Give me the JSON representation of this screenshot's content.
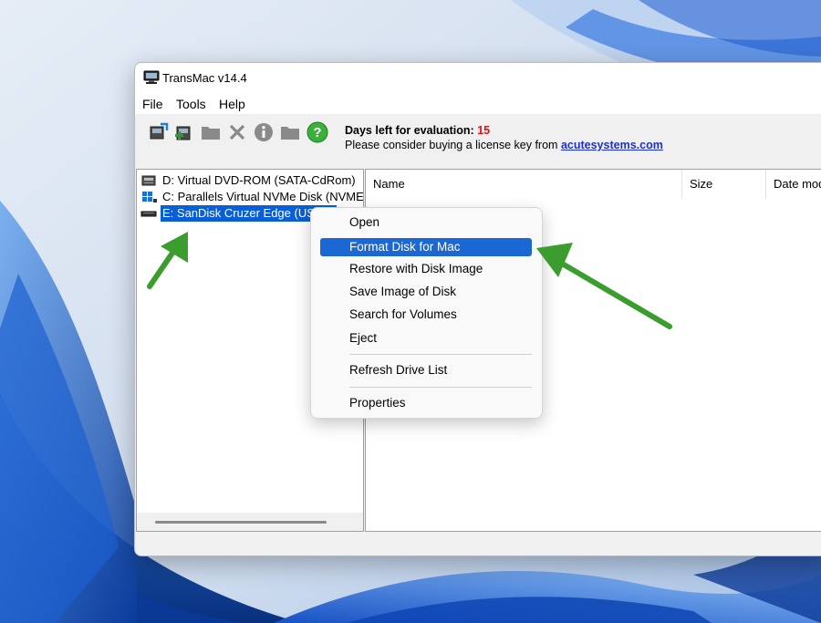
{
  "window": {
    "title": "TransMac v14.4"
  },
  "menubar": {
    "items": [
      "File",
      "Tools",
      "Help"
    ]
  },
  "toolbar": {
    "icons": [
      "refresh-drives-icon",
      "add-drive-icon",
      "folder-icon",
      "delete-icon",
      "info-icon",
      "new-folder-icon",
      "help-icon"
    ],
    "evaluation_label": "Days left for evaluation:",
    "evaluation_days": "15",
    "license_prompt": "Please consider buying a license key from",
    "license_link": "acutesystems.com"
  },
  "drives": [
    {
      "label": "D:  Virtual DVD-ROM (SATA-CdRom)",
      "icon": "dvd-drive-icon",
      "selected": false
    },
    {
      "label": "C:  Parallels Virtual NVMe Disk (NVME-D",
      "icon": "hard-disk-icon",
      "selected": false
    },
    {
      "label": "E: SanDisk Cruzer Edge (USB-D",
      "icon": "usb-drive-icon",
      "selected": true
    }
  ],
  "file_list": {
    "columns": [
      "Name",
      "Size",
      "Date mod"
    ]
  },
  "context_menu": {
    "items": [
      "Open",
      "Format Disk for Mac",
      "Restore with Disk Image",
      "Save Image of Disk",
      "Search for Volumes",
      "Eject",
      "Refresh Drive List",
      "Properties"
    ],
    "highlighted": "Format Disk for Mac"
  },
  "colors": {
    "selection": "#0a5fd6",
    "menu_highlight": "#1b67d3",
    "arrow": "#3a9d2d",
    "evaluation_days": "#e01010",
    "link": "#1a2fd8"
  }
}
